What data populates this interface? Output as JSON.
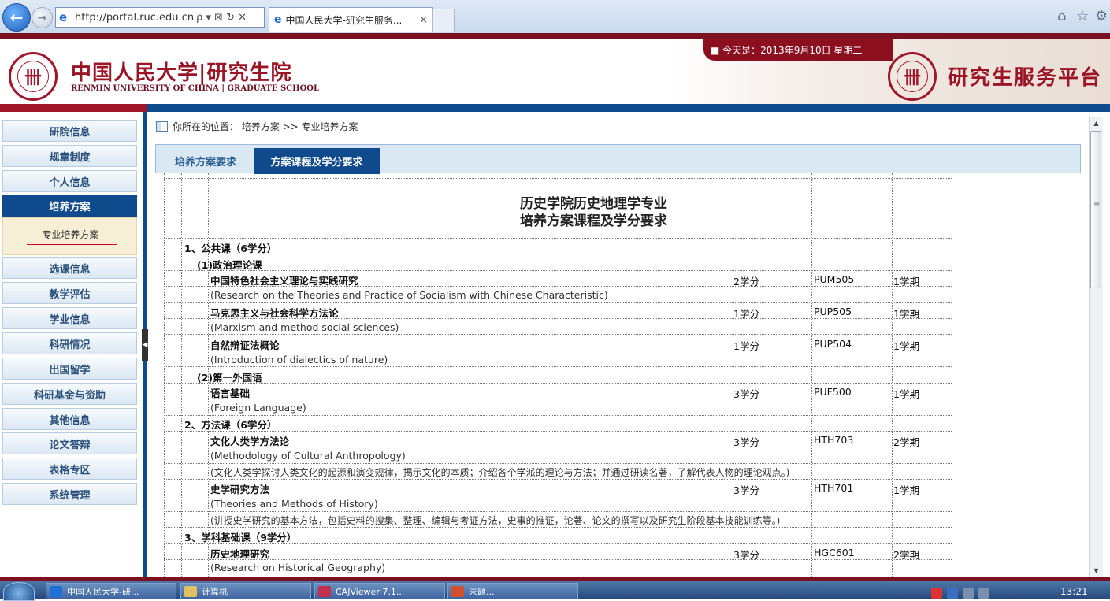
{
  "browser": {
    "url": "http://portal.ruc.edu.cn/y",
    "tab_title": "中国人民大学-研究生服务...",
    "address_controls": "ρ ▾ ⊠ ↻ ✕",
    "tab_close": "×"
  },
  "header": {
    "date_text": "■ 今天是：2013年9月10日  星期二",
    "logo_cn": "中国人民大学|研究生院",
    "logo_en": "RENMIN UNIVERSITY OF CHINA | GRADUATE SCHOOL",
    "platform_title": "研究生服务平台"
  },
  "sidebar": {
    "items": [
      {
        "label": "研院信息"
      },
      {
        "label": "规章制度"
      },
      {
        "label": "个人信息"
      },
      {
        "label": "培养方案"
      },
      {
        "label": "选课信息"
      },
      {
        "label": "教学评估"
      },
      {
        "label": "学业信息"
      },
      {
        "label": "科研情况"
      },
      {
        "label": "出国留学"
      },
      {
        "label": "科研基金与资助"
      },
      {
        "label": "其他信息"
      },
      {
        "label": "论文答辩"
      },
      {
        "label": "表格专区"
      },
      {
        "label": "系统管理"
      }
    ],
    "sub_item": "专业培养方案"
  },
  "breadcrumb": {
    "text": "你所在的位置：  培养方案 >> 专业培养方案"
  },
  "tabs": {
    "requirements": "培养方案要求",
    "courses": "方案课程及学分要求"
  },
  "document": {
    "title_line1": "历史学院历史地理学专业",
    "title_line2": "培养方案课程及学分要求",
    "rows": [
      {
        "text": "1、公共课（6学分）",
        "kind": "sec"
      },
      {
        "text": "(1)政治理论课",
        "kind": "sub"
      },
      {
        "text": "中国特色社会主义理论与实践研究",
        "kind": "course",
        "credits": "2学分",
        "code": "PUM505",
        "term": "1学期"
      },
      {
        "text": "(Research on the Theories and Practice of Socialism with Chinese Characteristic)",
        "kind": "en"
      },
      {
        "text": "马克思主义与社会科学方法论",
        "kind": "course",
        "credits": "1学分",
        "code": "PUP505",
        "term": "1学期"
      },
      {
        "text": "(Marxism and method social sciences)",
        "kind": "en"
      },
      {
        "text": "自然辩证法概论",
        "kind": "course",
        "credits": "1学分",
        "code": "PUP504",
        "term": "1学期"
      },
      {
        "text": "(Introduction of dialectics of nature)",
        "kind": "en"
      },
      {
        "text": "(2)第一外国语",
        "kind": "sub"
      },
      {
        "text": "语言基础",
        "kind": "course",
        "credits": "3学分",
        "code": "PUF500",
        "term": "1学期"
      },
      {
        "text": "(Foreign Language)",
        "kind": "en"
      },
      {
        "text": "2、方法课（6学分）",
        "kind": "sec"
      },
      {
        "text": "文化人类学方法论",
        "kind": "course",
        "credits": "3学分",
        "code": "HTH703",
        "term": "2学期"
      },
      {
        "text": "(Methodology of Cultural Anthropology)",
        "kind": "en"
      },
      {
        "text": "(文化人类学探讨人类文化的起源和演变规律，揭示文化的本质；介绍各个学派的理论与方法；并通过研读名著，了解代表人物的理论观点。)",
        "kind": "en"
      },
      {
        "text": "史学研究方法",
        "kind": "course",
        "credits": "3学分",
        "code": "HTH701",
        "term": "1学期"
      },
      {
        "text": "(Theories and Methods of History)",
        "kind": "en"
      },
      {
        "text": "(讲授史学研究的基本方法，包括史料的搜集、整理、编辑与考证方法，史事的推证，论著、论文的撰写以及研究生阶段基本技能训练等。)",
        "kind": "en"
      },
      {
        "text": "3、学科基础课（9学分）",
        "kind": "sec"
      },
      {
        "text": "历史地理研究",
        "kind": "course",
        "credits": "3学分",
        "code": "HGC601",
        "term": "2学期"
      },
      {
        "text": "(Research on Historical Geography)",
        "kind": "en"
      }
    ]
  },
  "taskbar": {
    "items": [
      {
        "label": "中国人民大学-研...",
        "color": "#1e6fd8"
      },
      {
        "label": "计算机",
        "color": "#e0c060"
      },
      {
        "label": "CAJViewer 7.1...",
        "color": "#c03050"
      },
      {
        "label": "未题...",
        "color": "#d05030"
      }
    ],
    "clock": "13:21"
  },
  "colors": {
    "brand_red": "#9b1526",
    "brand_blue": "#0e4a8c"
  }
}
